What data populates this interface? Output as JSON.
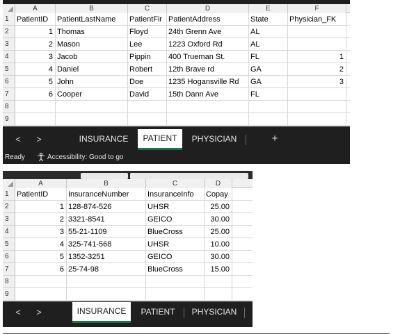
{
  "patient_window": {
    "columns": [
      "A",
      "B",
      "C",
      "D",
      "E",
      "F"
    ],
    "row_numbers": [
      "1",
      "2",
      "3",
      "4",
      "5",
      "6",
      "7",
      "8",
      "9"
    ],
    "header": [
      "PatientID",
      "PatientLastName",
      "PatientFir",
      "PatientAddress",
      "State",
      "Physician_FK"
    ],
    "rows": [
      [
        "1",
        "Thomas",
        "Floyd",
        "24th Grenn Ave",
        "AL",
        ""
      ],
      [
        "2",
        "Mason",
        "Lee",
        "1223 Oxford Rd",
        "AL",
        ""
      ],
      [
        "3",
        "Jacob",
        "Pippin",
        "400 Trueman St.",
        "FL",
        "1"
      ],
      [
        "4",
        "Daniel",
        "Robert",
        "12th Brave rd",
        "GA",
        "2"
      ],
      [
        "5",
        "John",
        "Doe",
        "1235 Hogansville Rd",
        "GA",
        "3"
      ],
      [
        "6",
        "Cooper",
        "David",
        "15th Dann Ave",
        "FL",
        ""
      ]
    ],
    "tabs": [
      "INSURANCE",
      "PATIENT",
      "PHYSICIAN"
    ],
    "active_tab": "PATIENT",
    "nav_prev": "<",
    "nav_next": ">",
    "add_sheet": "+",
    "status": {
      "ready": "Ready",
      "accessibility": "Accessibility: Good to go"
    }
  },
  "insurance_window": {
    "columns": [
      "A",
      "B",
      "C",
      "D"
    ],
    "row_numbers": [
      "1",
      "2",
      "3",
      "4",
      "5",
      "6",
      "7",
      "8",
      "9"
    ],
    "header": [
      "PatientID",
      "InsuranceNumber",
      "InsuranceInfo",
      "Copay"
    ],
    "rows": [
      [
        "1",
        "128-874-526",
        "UHSR",
        "25.00"
      ],
      [
        "2",
        "3321-8541",
        "GEICO",
        "30.00"
      ],
      [
        "3",
        "55-21-1109",
        "BlueCross",
        "25.00"
      ],
      [
        "4",
        "325-741-568",
        "UHSR",
        "10.00"
      ],
      [
        "5",
        "1352-3251",
        "GEICO",
        "30.00"
      ],
      [
        "6",
        "25-74-98",
        "BlueCross",
        "15.00"
      ]
    ],
    "tabs": [
      "INSURANCE",
      "PATIENT",
      "PHYSICIAN"
    ],
    "active_tab": "INSURANCE",
    "nav_prev": "<",
    "nav_next": ">"
  },
  "colors": {
    "active_tab_underline": "#1e7145",
    "chrome": "#1f1f1f",
    "header_fill": "#f0f0f0"
  }
}
